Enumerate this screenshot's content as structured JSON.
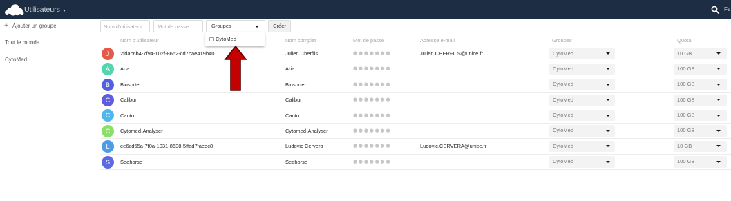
{
  "theme": {
    "header_bg": "#1d2d44",
    "annotation_arrow_fill": "#c40000",
    "annotation_arrow_stroke": "#5c0000"
  },
  "icons": {
    "logo": "cloud-logo",
    "app_menu": "chevron-down-icon",
    "search": "search-icon",
    "add_group": "plus-icon",
    "select": "chevron-down-icon",
    "checkbox": "checkbox-icon"
  },
  "header": {
    "app_title": "Utilisateurs",
    "user_label": "Fe"
  },
  "sidebar": {
    "add_group": {
      "glyph": "+",
      "label": "Ajouter un groupe"
    },
    "groups": [
      {
        "label": "Tout le monde"
      },
      {
        "label": "CytoMed"
      }
    ]
  },
  "new_user_form": {
    "username_placeholder": "Nom d'utilisateur",
    "password_placeholder": "Mot de passe",
    "groups_select_label": "Groupes",
    "groups_dropdown": {
      "open": true,
      "options": [
        {
          "label": "CytoMed",
          "checked": false
        }
      ]
    },
    "create_button": "Créer"
  },
  "users_table": {
    "columns": [
      "Nom d'utilisateur",
      "Nom complet",
      "Mot de passe",
      "Adresse e-mail",
      "Groupes",
      "Quota"
    ],
    "rows": [
      {
        "avatar_letter": "J",
        "avatar_color": "#e5594b",
        "username": "2fdac6b4-7f94-102f-8662-cd7bae419b40",
        "full_name": "Julien Cherfils",
        "password": "●●●●●●●",
        "email": "Julien.CHERFILS@unice.fr",
        "groups": "CytoMed",
        "quota": "10 GB"
      },
      {
        "avatar_letter": "A",
        "avatar_color": "#55d4ae",
        "username": "Aria",
        "full_name": "Aria",
        "password": "●●●●●●●",
        "email": "",
        "groups": "CytoMed",
        "quota": "100 GB"
      },
      {
        "avatar_letter": "B",
        "avatar_color": "#5060e0",
        "username": "Biosorter",
        "full_name": "Biosorter",
        "password": "●●●●●●●",
        "email": "",
        "groups": "CytoMed",
        "quota": "100 GB"
      },
      {
        "avatar_letter": "C",
        "avatar_color": "#5f5ddd",
        "username": "Calibur",
        "full_name": "Calibur",
        "password": "●●●●●●●",
        "email": "",
        "groups": "CytoMed",
        "quota": "100 GB"
      },
      {
        "avatar_letter": "C",
        "avatar_color": "#52b5ec",
        "username": "Canto",
        "full_name": "Canto",
        "password": "●●●●●●●",
        "email": "",
        "groups": "CytoMed",
        "quota": "100 GB"
      },
      {
        "avatar_letter": "C",
        "avatar_color": "#8bdf68",
        "username": "Cytomed-Analyser",
        "full_name": "Cytomed-Analyser",
        "password": "●●●●●●●",
        "email": "",
        "groups": "CytoMed",
        "quota": "100 GB"
      },
      {
        "avatar_letter": "L",
        "avatar_color": "#4d9ce5",
        "username": "ee6cd55a-7f0a-1031-8638-5ffad7faeec8",
        "full_name": "Ludovic Cervera",
        "password": "●●●●●●●",
        "email": "Ludovic.CERVERA@unice.fr",
        "groups": "CytoMed",
        "quota": "10 GB"
      },
      {
        "avatar_letter": "S",
        "avatar_color": "#5b69e3",
        "username": "Seahorse",
        "full_name": "Seahorse",
        "password": "●●●●●●●",
        "email": "",
        "groups": "CytoMed",
        "quota": "100 GB"
      }
    ]
  }
}
